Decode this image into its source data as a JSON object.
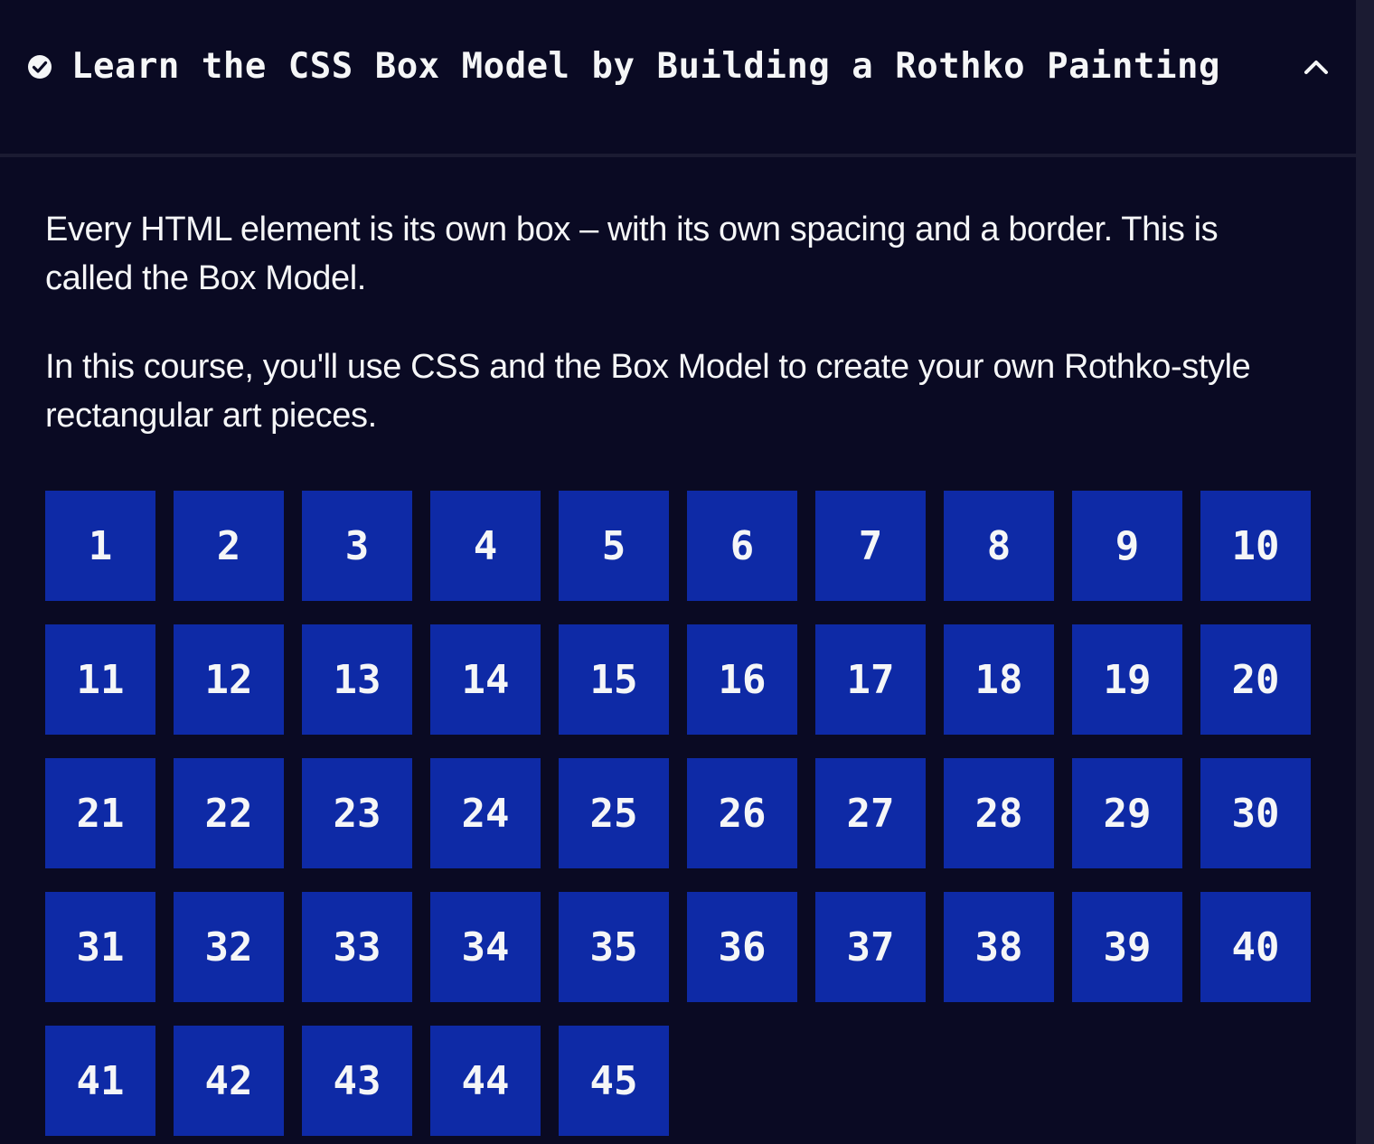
{
  "header": {
    "title": "Learn the CSS Box Model by Building a Rothko Painting",
    "status_icon": "check-circle-icon",
    "toggle_icon": "chevron-up-icon"
  },
  "description": [
    "Every HTML element is its own box – with its own spacing and a border. This is called the Box Model.",
    "In this course, you'll use CSS and the Box Model to create your own Rothko-style rectangular art pieces."
  ],
  "steps": [
    "1",
    "2",
    "3",
    "4",
    "5",
    "6",
    "7",
    "8",
    "9",
    "10",
    "11",
    "12",
    "13",
    "14",
    "15",
    "16",
    "17",
    "18",
    "19",
    "20",
    "21",
    "22",
    "23",
    "24",
    "25",
    "26",
    "27",
    "28",
    "29",
    "30",
    "31",
    "32",
    "33",
    "34",
    "35",
    "36",
    "37",
    "38",
    "39",
    "40",
    "41",
    "42",
    "43",
    "44",
    "45"
  ],
  "colors": {
    "background": "#0a0a23",
    "step_tile": "#0e2aa6",
    "text": "#f5f6f7",
    "divider": "#1b1b32"
  }
}
